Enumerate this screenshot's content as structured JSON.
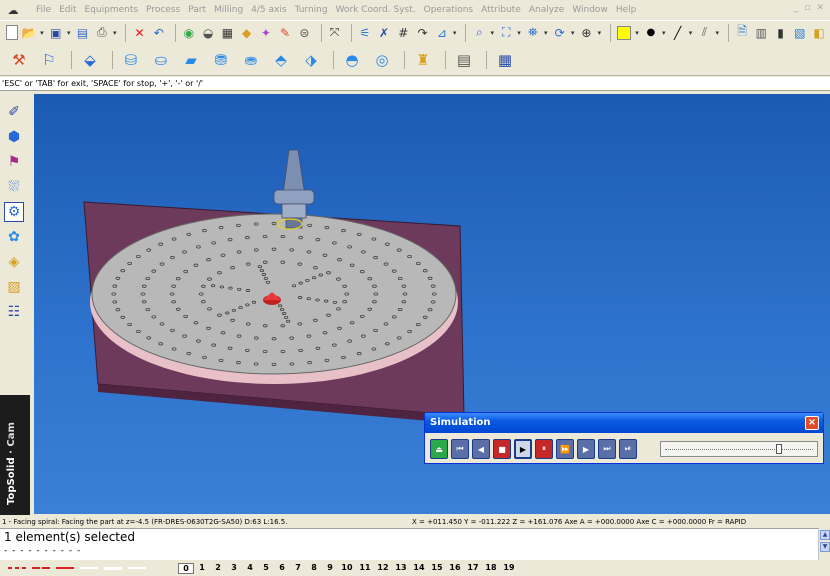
{
  "menu": [
    "File",
    "Edit",
    "Equipments",
    "Process",
    "Part",
    "Milling",
    "4/5 axis",
    "Turning",
    "Work Coord. Syst.",
    "Operations",
    "Attribute",
    "Analyze",
    "Window",
    "Help"
  ],
  "prompt": "'ESC' or 'TAB' for exit, 'SPACE' for stop, '+', '-' or '/'",
  "brand": {
    "left": "TopSolid",
    "right": "Cam"
  },
  "simulation": {
    "title": "Simulation",
    "close": "×",
    "progress": 0.78
  },
  "status": {
    "operation": "1 - Facing spiral: Facing the part at z=-4.5  (FR-DRES-0630T2G-SA50) D:63 L:16.5.",
    "coords": "X = +011.450  Y = -011.222   Z = +161.076  Axe A = +000.0000  Axe C = +000.0000  Fr = RAPID"
  },
  "message": {
    "line": "1 element(s) selected",
    "dashes": "- - - - - - - - - -"
  },
  "layers": [
    "0",
    "1",
    "2",
    "3",
    "4",
    "5",
    "6",
    "7",
    "8",
    "9",
    "10",
    "11",
    "12",
    "13",
    "14",
    "15",
    "16",
    "17",
    "18",
    "19"
  ],
  "colors": {
    "viewport": "#2d72cc",
    "titlebar": "#0a5ae0",
    "plate": "#6d3a5c",
    "disc": "#b8b8b8"
  }
}
